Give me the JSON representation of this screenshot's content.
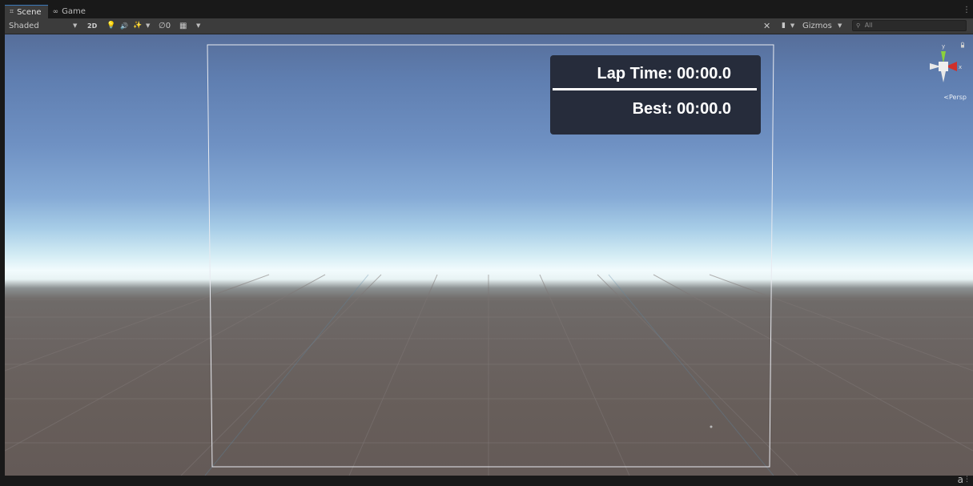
{
  "tabs": [
    {
      "label": "Scene",
      "icon": "scene-grid-icon",
      "glyph": "⌗",
      "active": true
    },
    {
      "label": "Game",
      "icon": "game-controller-icon",
      "glyph": "∞",
      "active": false
    }
  ],
  "tab_menu_glyph": "⋮",
  "toolbar": {
    "shading_mode": "Shaded",
    "two_d_label": "2D",
    "hidden_count": "0",
    "gizmos_label": "Gizmos",
    "search_placeholder": "All",
    "glyphs": {
      "lighting": "💡",
      "audio": "🔊",
      "effects": "✨",
      "visibility": "∅",
      "grid": "▦",
      "tools": "✕",
      "camera": "▮",
      "search": "⚲"
    }
  },
  "viewport": {
    "hud": {
      "lap_time": "Lap Time: 00:00.0",
      "best": "Best: 00:00.0"
    },
    "gizmo": {
      "y_label": "y",
      "x_label": "x",
      "lock_glyph": "🔒",
      "projection": "Persp"
    }
  },
  "status_bar": {
    "icon_glyph": "a",
    "menu_glyph": "⋮"
  },
  "colors": {
    "window_bg": "#282828",
    "toolbar_bg": "#3c3c3c",
    "hud_bg": "#262c3b",
    "gizmo_x": "#d0302b",
    "gizmo_y": "#8bd13b",
    "gizmo_z": "#3b7bd1"
  }
}
